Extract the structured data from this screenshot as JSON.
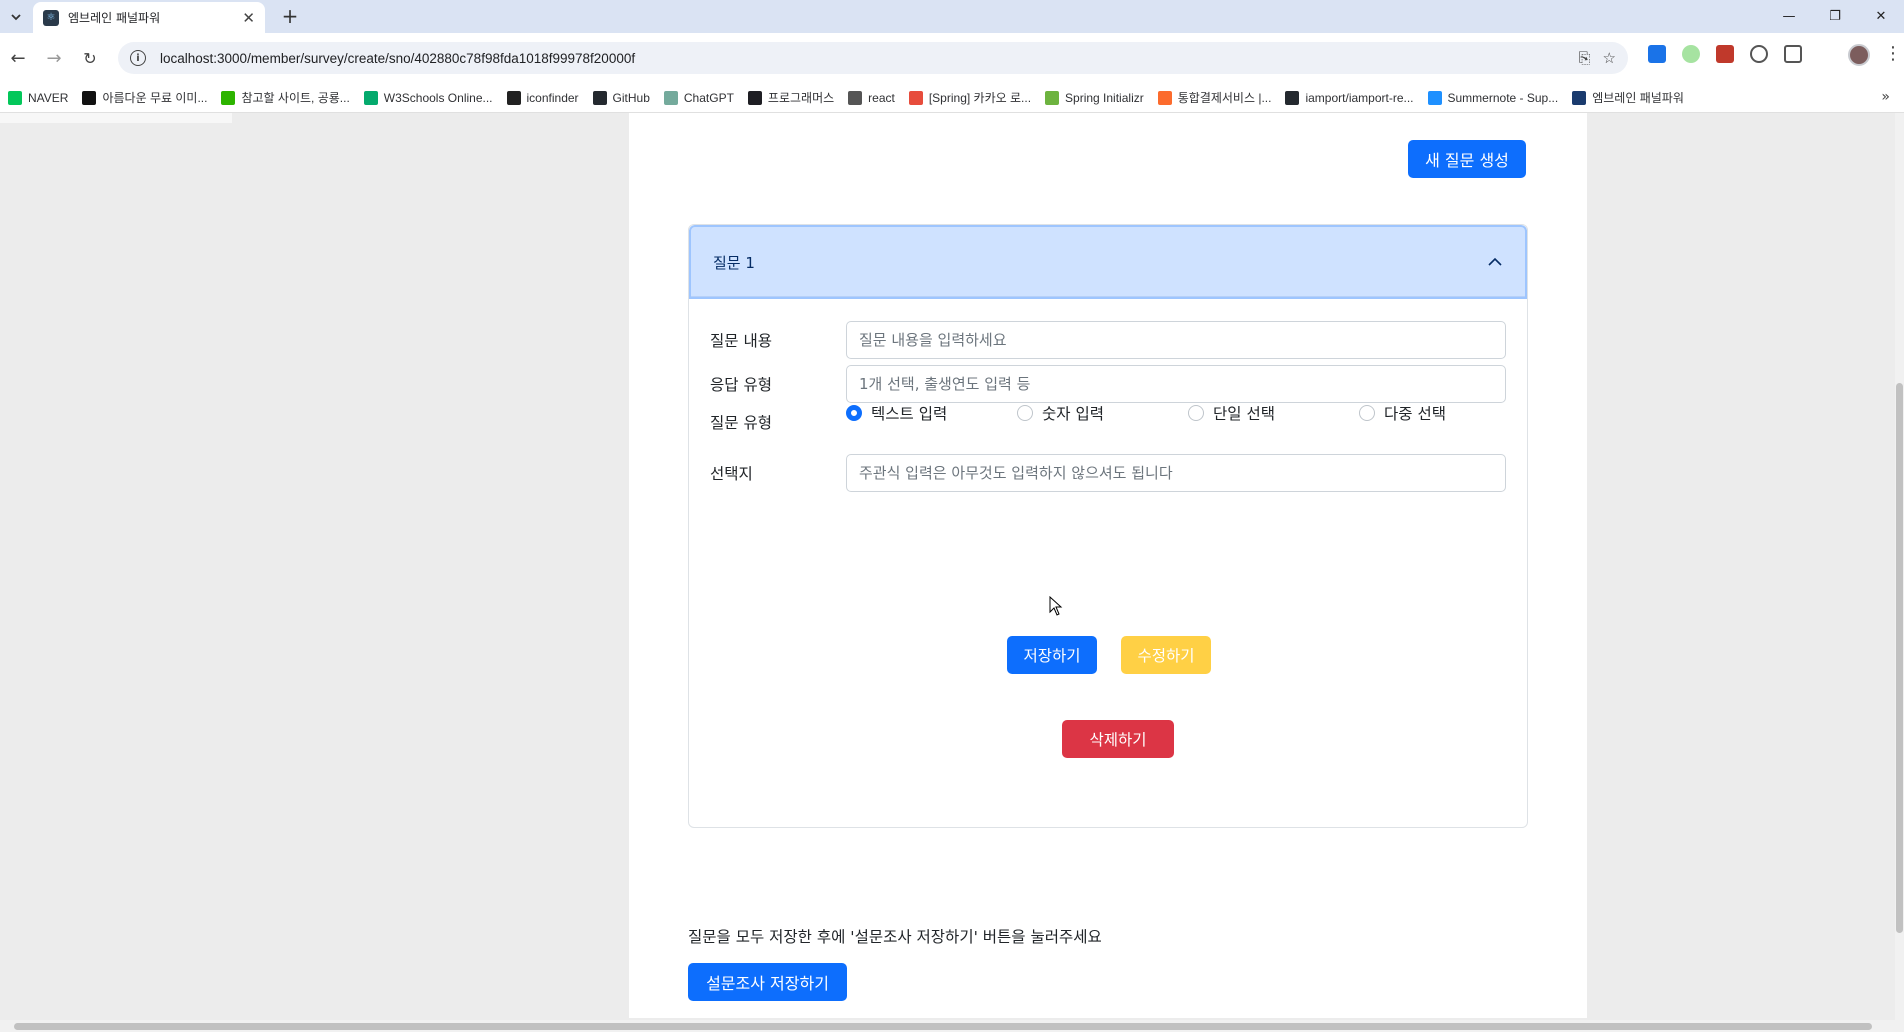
{
  "browser": {
    "tab_title": "엠브레인 패널파워",
    "url": "localhost:3000/member/survey/create/sno/402880c78f98fda1018f99978f20000f",
    "bookmarks": [
      {
        "label": "NAVER",
        "icon": "naver-icon",
        "color": "#03c75a"
      },
      {
        "label": "아름다운 무료 이미...",
        "icon": "unsplash-icon",
        "color": "#111111"
      },
      {
        "label": "참고할 사이트, 공룡...",
        "icon": "blog-icon",
        "color": "#2db400"
      },
      {
        "label": "W3Schools Online...",
        "icon": "w3schools-icon",
        "color": "#04aa6d"
      },
      {
        "label": "iconfinder",
        "icon": "iconfinder-icon",
        "color": "#222222"
      },
      {
        "label": "GitHub",
        "icon": "github-icon",
        "color": "#24292f"
      },
      {
        "label": "ChatGPT",
        "icon": "chatgpt-icon",
        "color": "#74aa9c"
      },
      {
        "label": "프로그래머스",
        "icon": "programmers-icon",
        "color": "#1e1e23"
      },
      {
        "label": "react",
        "icon": "folder-icon",
        "color": "#555555"
      },
      {
        "label": "[Spring] 카카오 로...",
        "icon": "velog-icon",
        "color": "#e74c3c"
      },
      {
        "label": "Spring Initializr",
        "icon": "spring-icon",
        "color": "#6db33f"
      },
      {
        "label": "통합결제서비스 |...",
        "icon": "portone-icon",
        "color": "#fc6b2d"
      },
      {
        "label": "iamport/iamport-re...",
        "icon": "github-icon",
        "color": "#24292f"
      },
      {
        "label": "Summernote - Sup...",
        "icon": "summernote-icon",
        "color": "#1e90ff"
      },
      {
        "label": "엠브레인 패널파워",
        "icon": "embrain-icon",
        "color": "#1a3b6e"
      }
    ]
  },
  "page": {
    "new_question_label": "새 질문 생성",
    "question": {
      "title": "질문 1",
      "content_label": "질문 내용",
      "content_placeholder": "질문 내용을 입력하세요",
      "answer_type_label": "응답 유형",
      "answer_type_placeholder": "1개 선택, 출생연도 입력 등",
      "question_type_label": "질문 유형",
      "question_types": [
        {
          "label": "텍스트 입력",
          "checked": true
        },
        {
          "label": "숫자 입력",
          "checked": false
        },
        {
          "label": "단일 선택",
          "checked": false
        },
        {
          "label": "다중 선택",
          "checked": false
        }
      ],
      "options_label": "선택지",
      "options_placeholder": "주관식 입력은 아무것도 입력하지 않으셔도 됩니다",
      "save_label": "저장하기",
      "edit_label": "수정하기",
      "delete_label": "삭제하기"
    },
    "notice": "질문을 모두 저장한 후에 '설문조사 저장하기' 버튼을 눌러주세요",
    "survey_save_label": "설문조사 저장하기"
  },
  "colors": {
    "primary": "#0d6efd",
    "warning": "#ffc107",
    "danger": "#dc3545",
    "accordion_header": "#cfe2ff"
  }
}
